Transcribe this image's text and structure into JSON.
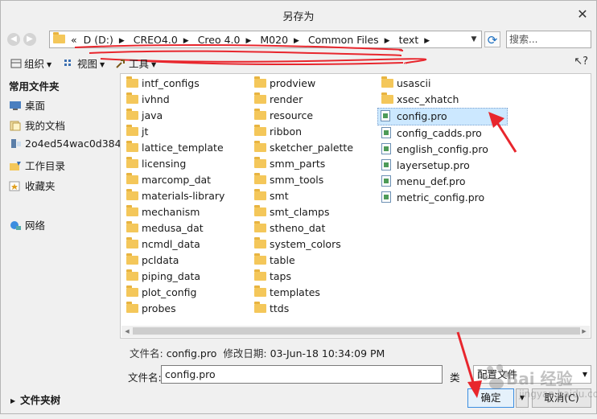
{
  "window": {
    "title": "另存为",
    "close": "✕"
  },
  "address_bar": {
    "crumbs": [
      "D (D:)",
      "CREO4.0",
      "Creo 4.0",
      "M020",
      "Common Files",
      "text"
    ],
    "lead_chevron": "«",
    "separator": "▶"
  },
  "search": {
    "placeholder": "搜索..."
  },
  "toolbar": {
    "organize": "组织",
    "view": "视图",
    "tools": "工具",
    "help": "?"
  },
  "sidebar": {
    "heading": "常用文件夹",
    "items": [
      {
        "label": "桌面",
        "icon": "desktop-icon"
      },
      {
        "label": "我的文档",
        "icon": "documents-icon"
      },
      {
        "label": "2o4ed54wac0d384",
        "icon": "computer-icon"
      },
      {
        "label": "工作目录",
        "icon": "working-directory-icon"
      },
      {
        "label": "收藏夹",
        "icon": "favorites-icon"
      },
      {
        "label": "网络",
        "icon": "network-icon"
      }
    ]
  },
  "files": {
    "column1": [
      "intf_configs",
      "ivhnd",
      "java",
      "jt",
      "lattice_template",
      "licensing",
      "marcomp_dat",
      "materials-library",
      "mechanism",
      "medusa_dat",
      "ncmdl_data",
      "pcldata",
      "piping_data",
      "plot_config",
      "probes"
    ],
    "column2": [
      "prodview",
      "render",
      "resource",
      "ribbon",
      "sketcher_palette",
      "smm_parts",
      "smm_tools",
      "smt",
      "smt_clamps",
      "stheno_dat",
      "system_colors",
      "table",
      "taps",
      "templates",
      "ttds"
    ],
    "column3_folders": [
      "usascii",
      "xsec_xhatch"
    ],
    "column3_files": [
      "config.pro",
      "config_cadds.pro",
      "english_config.pro",
      "layersetup.pro",
      "menu_def.pro",
      "metric_config.pro"
    ],
    "selected": "config.pro"
  },
  "info": {
    "name_label": "文件名:",
    "name_value": "config.pro",
    "modified_label": "修改日期:",
    "modified_value": "03-Jun-18 10:34:09 PM"
  },
  "form": {
    "filename_label": "文件名:",
    "filename_value": "config.pro",
    "type_label": "类",
    "type_value": "配置文件"
  },
  "footer": {
    "folder_tree_label": "文件夹树",
    "ok_label": "确定",
    "cancel_label": "取消(C)"
  },
  "watermark": {
    "text": "Bai 经验",
    "sub": "jingyan.baidu.com"
  },
  "colors": {
    "accent": "#3b8de0",
    "selection": "#cce8ff",
    "annotation": "#e8262d",
    "folder": "#f4c75a"
  }
}
